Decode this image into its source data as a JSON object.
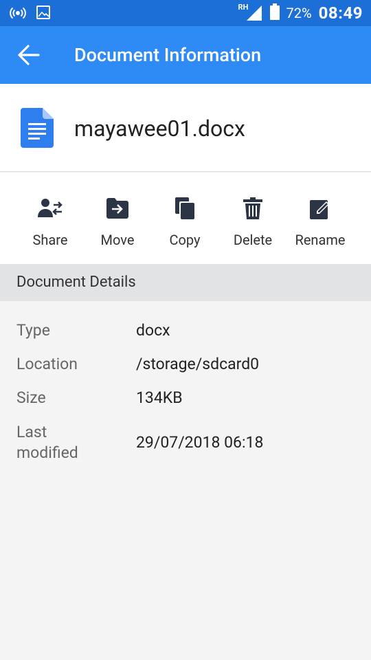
{
  "status_bar": {
    "icons": [
      "hotspot-icon",
      "image-icon",
      "signal-icon",
      "battery-icon"
    ],
    "signal_label": "RH",
    "battery": "72%",
    "time": "08:49"
  },
  "app_bar": {
    "back_icon": "arrow-left-icon",
    "title": "Document Information"
  },
  "file": {
    "icon": "google-docs-icon",
    "name": "mayawee01.docx"
  },
  "actions": [
    {
      "label": "Share",
      "icon": "share-people-icon"
    },
    {
      "label": "Move",
      "icon": "move-folder-icon"
    },
    {
      "label": "Copy",
      "icon": "copy-icon"
    },
    {
      "label": "Delete",
      "icon": "trash-icon"
    },
    {
      "label": "Rename",
      "icon": "edit-icon"
    }
  ],
  "details": {
    "heading": "Document Details",
    "rows": [
      {
        "key": "Type",
        "value": "docx"
      },
      {
        "key": "Location",
        "value": "/storage/sdcard0"
      },
      {
        "key": "Size",
        "value": "134KB"
      },
      {
        "key": "Last modified",
        "value": "29/07/2018 06:18"
      }
    ]
  },
  "colors": {
    "status_bar": "#1d6fd8",
    "app_bar": "#2e8bf5",
    "doc_icon": "#2f7ef0",
    "action_icon": "#2b3545"
  }
}
